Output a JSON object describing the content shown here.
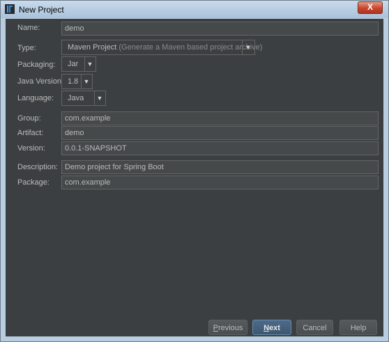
{
  "window": {
    "title": "New Project",
    "close_label": "X"
  },
  "form": {
    "name": {
      "label": "Name:",
      "value": "demo"
    },
    "type": {
      "label": "Type:",
      "value": "Maven Project",
      "hint": "(Generate a Maven based project archive)"
    },
    "packaging": {
      "label": "Packaging:",
      "value": "Jar"
    },
    "java": {
      "label": "Java Version:",
      "value": "1.8"
    },
    "language": {
      "label": "Language:",
      "value": "Java"
    },
    "group": {
      "label": "Group:",
      "value": "com.example"
    },
    "artifact": {
      "label": "Artifact:",
      "value": "demo"
    },
    "version": {
      "label": "Version:",
      "value": "0.0.1-SNAPSHOT"
    },
    "description": {
      "label": "Description:",
      "value": "Demo project for Spring Boot"
    },
    "package": {
      "label": "Package:",
      "value": "com.example"
    }
  },
  "buttons": {
    "previous": "Previous",
    "next": "Next",
    "cancel": "Cancel",
    "help": "Help"
  },
  "colors": {
    "background": "#3c3f41",
    "field": "#45494a",
    "text": "#bbbbbb",
    "default_button": "#3d5770"
  }
}
